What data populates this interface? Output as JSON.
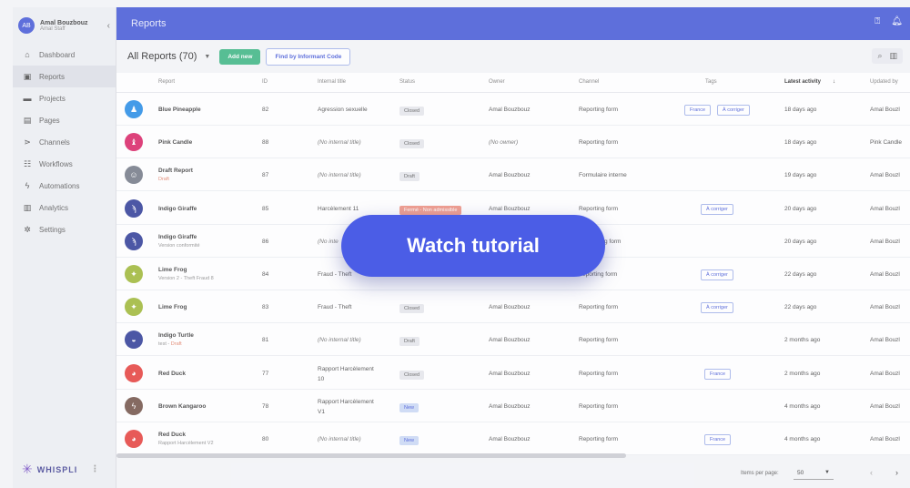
{
  "user": {
    "initials": "AB",
    "name": "Amal Bouzbouz",
    "role": "Amal Staff"
  },
  "sidebar": {
    "items": [
      {
        "label": "Dashboard",
        "icon": "home-icon",
        "glyph": "⌂"
      },
      {
        "label": "Reports",
        "icon": "report-icon",
        "glyph": "▣",
        "active": true
      },
      {
        "label": "Projects",
        "icon": "folder-icon",
        "glyph": "▬"
      },
      {
        "label": "Pages",
        "icon": "pages-icon",
        "glyph": "▤"
      },
      {
        "label": "Channels",
        "icon": "channels-icon",
        "glyph": "⋗"
      },
      {
        "label": "Workflows",
        "icon": "workflow-icon",
        "glyph": "☷"
      },
      {
        "label": "Automations",
        "icon": "lightning-icon",
        "glyph": "ϟ"
      },
      {
        "label": "Analytics",
        "icon": "chart-icon",
        "glyph": "▥"
      },
      {
        "label": "Settings",
        "icon": "gear-icon",
        "glyph": "✲"
      }
    ]
  },
  "logo": {
    "text": "WHISPLI"
  },
  "header": {
    "title": "Reports"
  },
  "toolbar": {
    "title": "All Reports (70)",
    "add_new": "Add new",
    "find_by_code": "Find by Informant Code"
  },
  "table": {
    "headers": {
      "report": "Report",
      "id": "ID",
      "internal_title": "Internal title",
      "status": "Status",
      "owner": "Owner",
      "channel": "Channel",
      "tags": "Tags",
      "latest_activity": "Latest activity",
      "updated_by": "Updated by"
    },
    "rows": [
      {
        "name": "Blue Pineapple",
        "sub": "",
        "id": "82",
        "title": "Agression sexuelle",
        "title2": "",
        "title_italic": false,
        "status": "Closed",
        "status_type": "closed",
        "owner": "Amal Bouzbouz",
        "channel": "Reporting form",
        "tags": [
          "France",
          "À corriger"
        ],
        "activity": "18 days ago",
        "updated_by": "Amal Bouzl",
        "icon_color": "#1e88e5",
        "glyph": "♟"
      },
      {
        "name": "Pink Candle",
        "sub": "",
        "id": "88",
        "title": "(No internal title)",
        "title2": "",
        "title_italic": true,
        "status": "Closed",
        "status_type": "closed",
        "owner": "(No owner)",
        "channel": "Reporting form",
        "tags": [],
        "activity": "18 days ago",
        "updated_by": "Pink Candle",
        "icon_color": "#d81b60",
        "glyph": "♝"
      },
      {
        "name": "Draft Report",
        "sub": "Draft",
        "sub_draft": true,
        "id": "87",
        "title": "(No internal title)",
        "title2": "",
        "title_italic": true,
        "status": "Draft",
        "status_type": "closed",
        "owner": "Amal Bouzbouz",
        "channel": "Formulaire interne",
        "tags": [],
        "activity": "19 days ago",
        "updated_by": "Amal Bouzl",
        "icon_color": "#6e7582",
        "glyph": "☺"
      },
      {
        "name": "Indigo Giraffe",
        "sub": "",
        "id": "85",
        "title": "Harcèlement 11",
        "title2": "",
        "title_italic": false,
        "status": "Fermé - Non admissible",
        "status_type": "ferme",
        "owner": "Amal Bouzbouz",
        "channel": "Reporting form",
        "tags": [
          "À corriger"
        ],
        "activity": "20 days ago",
        "updated_by": "Amal Bouzl",
        "icon_color": "#283593",
        "glyph": "ϡ"
      },
      {
        "name": "Indigo Giraffe",
        "sub": "Version conformité",
        "id": "86",
        "title": "(No inte",
        "title2": "",
        "title_italic": true,
        "status": "",
        "status_type": "",
        "owner": "",
        "channel": "g form",
        "tags": [],
        "activity": "20 days ago",
        "updated_by": "Amal Bouzl",
        "icon_color": "#283593",
        "glyph": "ϡ"
      },
      {
        "name": "Lime Frog",
        "sub": "Version 2 - Theft Fraud 8",
        "id": "84",
        "title": "Fraud - Theft",
        "title2": "",
        "title_italic": false,
        "status": "",
        "status_type": "",
        "owner": "",
        "channel": "eporting form",
        "tags": [
          "À corriger"
        ],
        "activity": "22 days ago",
        "updated_by": "Amal Bouzl",
        "icon_color": "#9bb52f",
        "glyph": "✦"
      },
      {
        "name": "Lime Frog",
        "sub": "",
        "id": "83",
        "title": "Fraud - Theft",
        "title2": "",
        "title_italic": false,
        "status": "Closed",
        "status_type": "closed",
        "owner": "Amal Bouzbouz",
        "channel": "Reporting form",
        "tags": [
          "À corriger"
        ],
        "activity": "22 days ago",
        "updated_by": "Amal Bouzl",
        "icon_color": "#9bb52f",
        "glyph": "✦"
      },
      {
        "name": "Indigo Turtle",
        "sub": "test - ",
        "sub_draft_text": "Draft",
        "id": "81",
        "title": "(No internal title)",
        "title2": "",
        "title_italic": true,
        "status": "Draft",
        "status_type": "closed",
        "owner": "Amal Bouzbouz",
        "channel": "Reporting form",
        "tags": [],
        "activity": "2 months ago",
        "updated_by": "Amal Bouzl",
        "icon_color": "#283593",
        "glyph": "◒"
      },
      {
        "name": "Red Duck",
        "sub": "",
        "id": "77",
        "title": "Rapport Harcèlement",
        "title2": "10",
        "title_italic": false,
        "status": "Closed",
        "status_type": "closed",
        "owner": "Amal Bouzbouz",
        "channel": "Reporting form",
        "tags": [
          "France"
        ],
        "activity": "2 months ago",
        "updated_by": "Amal Bouzl",
        "icon_color": "#e53935",
        "glyph": "◕"
      },
      {
        "name": "Brown Kangaroo",
        "sub": "",
        "id": "78",
        "title": "Rapport Harcèlement",
        "title2": "V1",
        "title_italic": false,
        "status": "New",
        "status_type": "new",
        "owner": "Amal Bouzbouz",
        "channel": "Reporting form",
        "tags": [],
        "activity": "4 months ago",
        "updated_by": "Amal Bouzl",
        "icon_color": "#6d4c41",
        "glyph": "ϟ"
      },
      {
        "name": "Red Duck",
        "sub": "Rapport Harcèlement V2",
        "id": "80",
        "title": "(No internal title)",
        "title2": "",
        "title_italic": true,
        "status": "New",
        "status_type": "new",
        "owner": "Amal Bouzbouz",
        "channel": "Reporting form",
        "tags": [
          "France"
        ],
        "activity": "4 months ago",
        "updated_by": "Amal Bouzl",
        "icon_color": "#e53935",
        "glyph": "◕"
      }
    ]
  },
  "footer": {
    "items_per_page_label": "Items per page:",
    "items_per_page_value": "50"
  },
  "overlay": {
    "watch_tutorial": "Watch tutorial"
  }
}
